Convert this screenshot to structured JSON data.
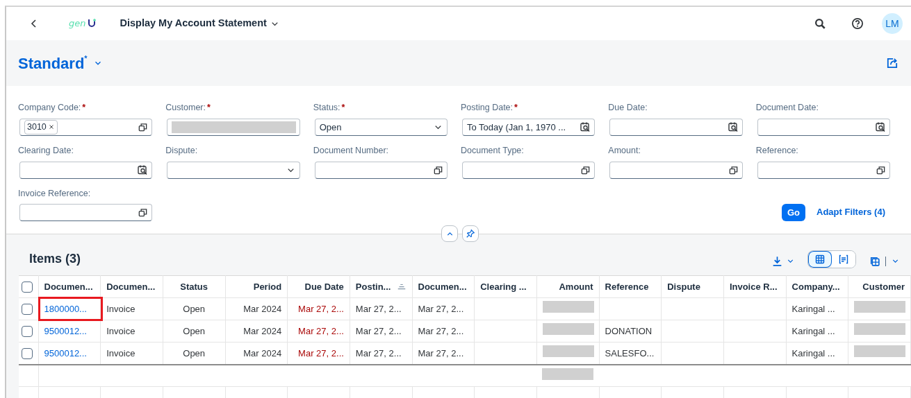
{
  "shell": {
    "logo": "gen",
    "title": "Display My Account Statement",
    "avatar": "LM"
  },
  "variant": {
    "title": "Standard$^{*}$"
  },
  "filters": [
    {
      "label": "Company Code:",
      "required_mark": "*",
      "kind": "value-help",
      "tokens": [
        "3010"
      ]
    },
    {
      "label": "Customer:",
      "required_mark": "*",
      "kind": "redacted"
    },
    {
      "label": "Status:",
      "required_mark": "*",
      "kind": "select",
      "value": "Open"
    },
    {
      "label": "Posting Date:",
      "required_mark": "*",
      "kind": "date",
      "value": "To Today (Jan 1, 1970 ..."
    },
    {
      "label": "Due Date:",
      "kind": "date"
    },
    {
      "label": "Document Date:",
      "kind": "date"
    },
    {
      "label": "Clearing Date:",
      "kind": "date"
    },
    {
      "label": "Dispute:",
      "kind": "select"
    },
    {
      "label": "Document Number:",
      "kind": "value-help"
    },
    {
      "label": "Document Type:",
      "kind": "value-help"
    },
    {
      "label": "Amount:",
      "kind": "value-help"
    },
    {
      "label": "Reference:",
      "kind": "value-help"
    },
    {
      "label": "Invoice Reference:",
      "kind": "value-help"
    }
  ],
  "filter_actions": {
    "go": "Go",
    "adapt": "Adapt Filters (4)"
  },
  "table": {
    "title": "Items (3)",
    "view_modes": [
      {
        "selected": true
      },
      {
        "selected": false
      }
    ],
    "select_all": {
      "checked": false
    },
    "columns": [
      {
        "label": "Documen...",
        "sorted": false
      },
      {
        "label": "Documen...",
        "sorted": false
      },
      {
        "label": "Status",
        "sorted": false
      },
      {
        "label": "Period",
        "sorted": false
      },
      {
        "label": "Due Date",
        "sorted": false
      },
      {
        "label": "Postin...",
        "sorted": true
      },
      {
        "label": "Documen...",
        "sorted": false
      },
      {
        "label": "Clearing ...",
        "sorted": false
      },
      {
        "label": "Amount",
        "sorted": false
      },
      {
        "label": "Reference",
        "sorted": false
      },
      {
        "label": "Dispute",
        "sorted": false
      },
      {
        "label": "Invoice R...",
        "sorted": false
      },
      {
        "label": "Company...",
        "sorted": false
      },
      {
        "label": "Customer",
        "sorted": false
      }
    ],
    "rows": [
      {
        "checked": false,
        "cells": [
          {
            "kind": "link",
            "text": "1800000...",
            "highlighted": true
          },
          {
            "text": "Invoice"
          },
          {
            "text": "Open"
          },
          {
            "text": "Mar 2024"
          },
          {
            "kind": "overdue",
            "text": "Mar 27, 2..."
          },
          {
            "text": "Mar 27, 2..."
          },
          {
            "text": "Mar 27, 2..."
          },
          {
            "kind": "empty"
          },
          {
            "kind": "redacted"
          },
          {
            "kind": "empty"
          },
          {
            "kind": "empty"
          },
          {
            "kind": "empty"
          },
          {
            "text": "Karingal ..."
          },
          {
            "kind": "redacted"
          }
        ]
      },
      {
        "checked": false,
        "cells": [
          {
            "kind": "link",
            "text": "9500012...",
            "highlighted": false
          },
          {
            "text": "Invoice"
          },
          {
            "text": "Open"
          },
          {
            "text": "Mar 2024"
          },
          {
            "kind": "overdue",
            "text": "Mar 27, 2..."
          },
          {
            "text": "Mar 27, 2..."
          },
          {
            "text": "Mar 27, 2..."
          },
          {
            "kind": "empty"
          },
          {
            "kind": "redacted"
          },
          {
            "text": "DONATION"
          },
          {
            "kind": "empty"
          },
          {
            "kind": "empty"
          },
          {
            "text": "Karingal ..."
          },
          {
            "kind": "redacted"
          }
        ]
      },
      {
        "checked": false,
        "cells": [
          {
            "kind": "link",
            "text": "9500012...",
            "highlighted": false
          },
          {
            "text": "Invoice"
          },
          {
            "text": "Open"
          },
          {
            "text": "Mar 2024"
          },
          {
            "kind": "overdue",
            "text": "Mar 27, 2..."
          },
          {
            "text": "Mar 27, 2..."
          },
          {
            "text": "Mar 27, 2..."
          },
          {
            "kind": "empty"
          },
          {
            "kind": "redacted"
          },
          {
            "text": "SALESFO..."
          },
          {
            "kind": "empty"
          },
          {
            "kind": "empty"
          },
          {
            "text": "Karingal ..."
          },
          {
            "kind": "redacted"
          }
        ]
      }
    ],
    "totals": [
      {
        "kind": "empty"
      },
      {
        "kind": "empty"
      },
      {
        "kind": "empty"
      },
      {
        "kind": "empty"
      },
      {
        "kind": "empty"
      },
      {
        "kind": "empty"
      },
      {
        "kind": "empty"
      },
      {
        "kind": "empty"
      },
      {
        "kind": "redacted"
      },
      {
        "kind": "empty"
      },
      {
        "kind": "empty"
      },
      {
        "kind": "empty"
      },
      {
        "kind": "empty"
      },
      {
        "kind": "empty"
      }
    ]
  }
}
